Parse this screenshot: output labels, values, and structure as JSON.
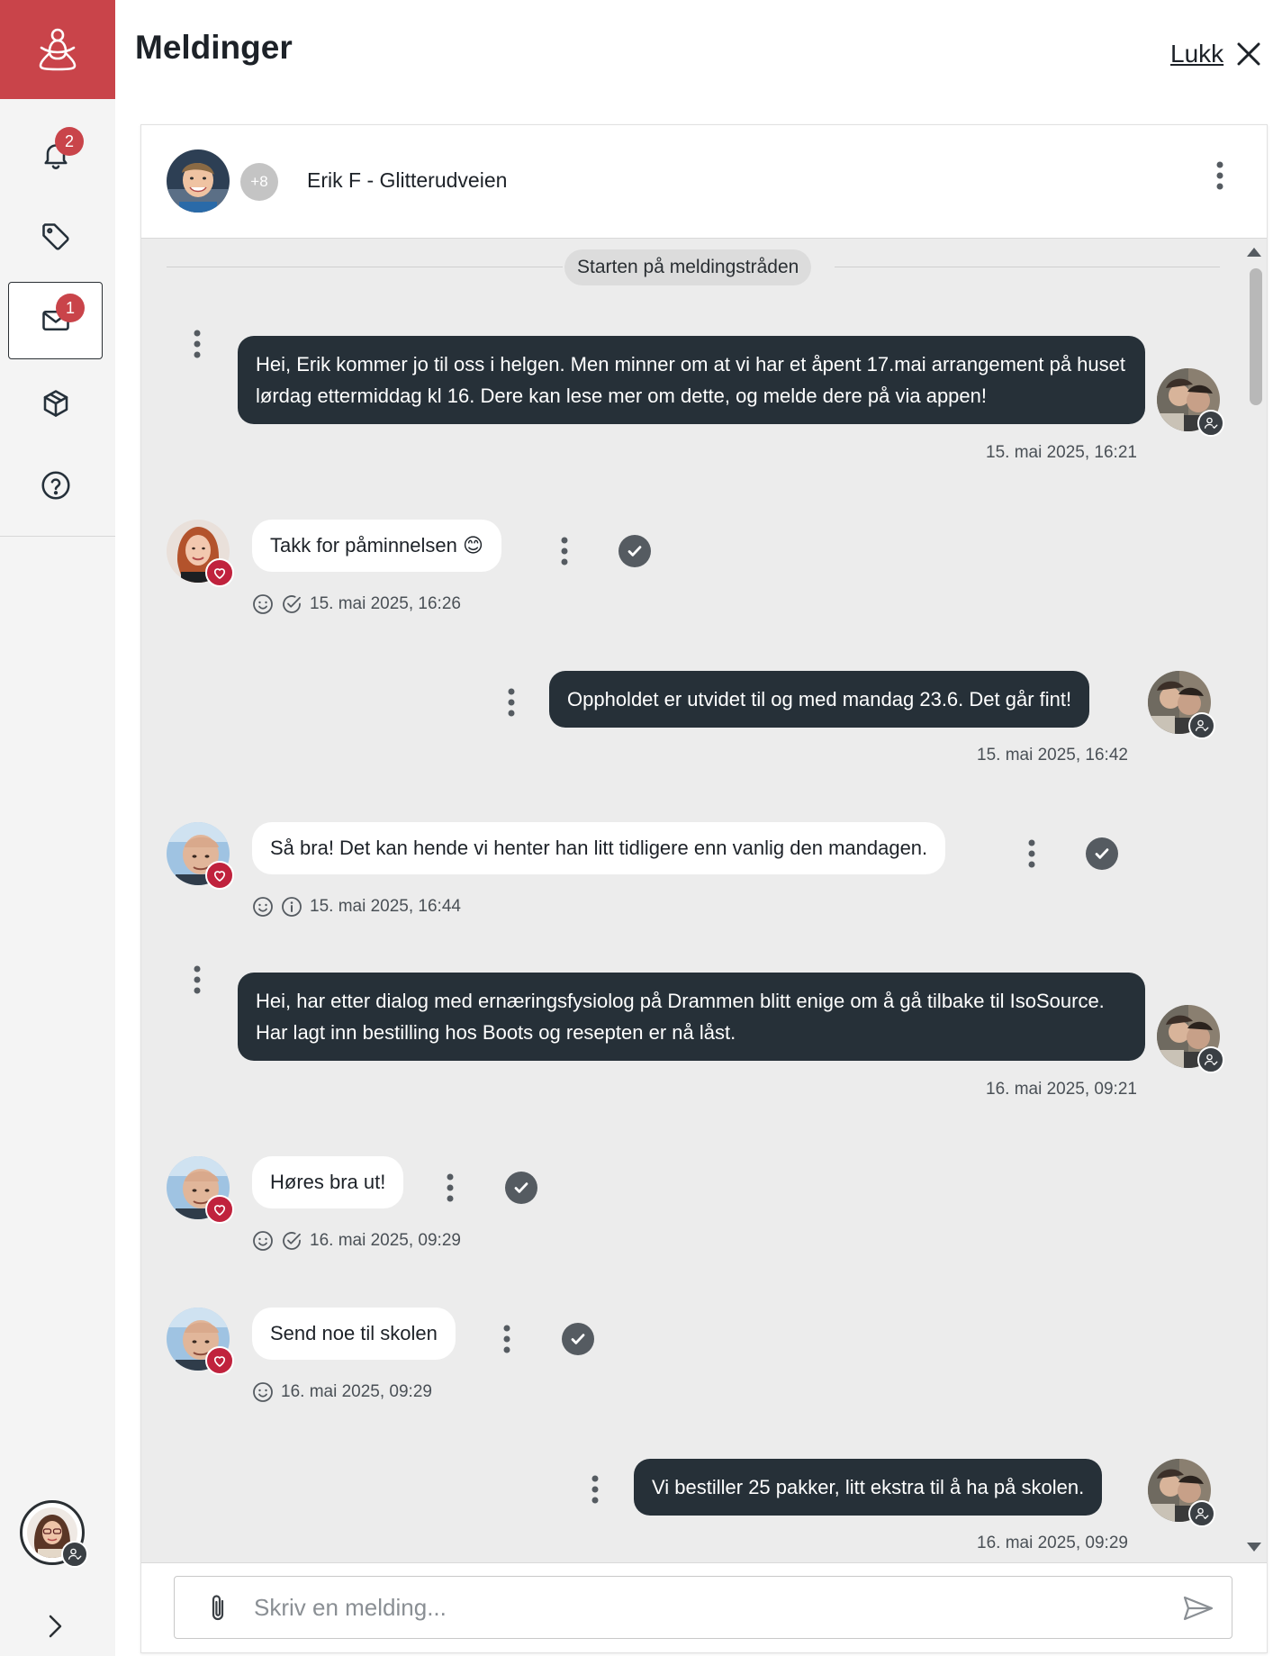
{
  "sidebar": {
    "notifications_badge": "2",
    "messages_badge": "1",
    "items": [
      "bell-icon",
      "tag-icon",
      "mail-icon",
      "package-icon",
      "help-icon"
    ]
  },
  "header": {
    "title": "Meldinger",
    "close_label": "Lukk"
  },
  "thread": {
    "extra_participants": "+8",
    "name": "Erik F - Glitterudveien",
    "start_label": "Starten på meldingstråden"
  },
  "messages": [
    {
      "direction": "out",
      "text": "Hei, Erik kommer jo til oss i helgen. Men minner om at vi har et åpent 17.mai arrangement på huset lørdag ettermiddag kl 16. Dere kan lese mer om dette, og melde dere på via appen!",
      "timestamp": "15. mai 2025, 16:21"
    },
    {
      "direction": "in",
      "text": "Takk for påminnelsen 😊",
      "timestamp": "15. mai 2025, 16:26",
      "status_icon": "check-circle-icon"
    },
    {
      "direction": "out",
      "text": "Oppholdet er utvidet til og med mandag 23.6. Det går fint!",
      "timestamp": "15. mai 2025, 16:42"
    },
    {
      "direction": "in",
      "text": "Så bra! Det kan hende vi henter han litt tidligere enn vanlig den mandagen.",
      "timestamp": "15. mai 2025, 16:44",
      "status_icon": "info-icon"
    },
    {
      "direction": "out",
      "text": "Hei, har etter dialog med ernæringsfysiolog på Drammen blitt enige om å gå tilbake til IsoSource. Har lagt inn bestilling hos Boots og resepten er nå låst.",
      "timestamp": "16. mai 2025, 09:21"
    },
    {
      "direction": "in",
      "text": "Høres bra ut!",
      "timestamp": "16. mai 2025, 09:29",
      "status_icon": "check-circle-icon"
    },
    {
      "direction": "in",
      "text": "Send noe til skolen",
      "timestamp": "16. mai 2025, 09:29"
    },
    {
      "direction": "out",
      "text": "Vi bestiller 25 pakker, litt ekstra til å ha på skolen.",
      "timestamp": "16. mai 2025, 09:29"
    }
  ],
  "composer": {
    "placeholder": "Skriv en melding..."
  },
  "colors": {
    "brand_red": "#c9444a",
    "outgoing_bubble": "#263038",
    "heart_badge": "#c0223d"
  }
}
